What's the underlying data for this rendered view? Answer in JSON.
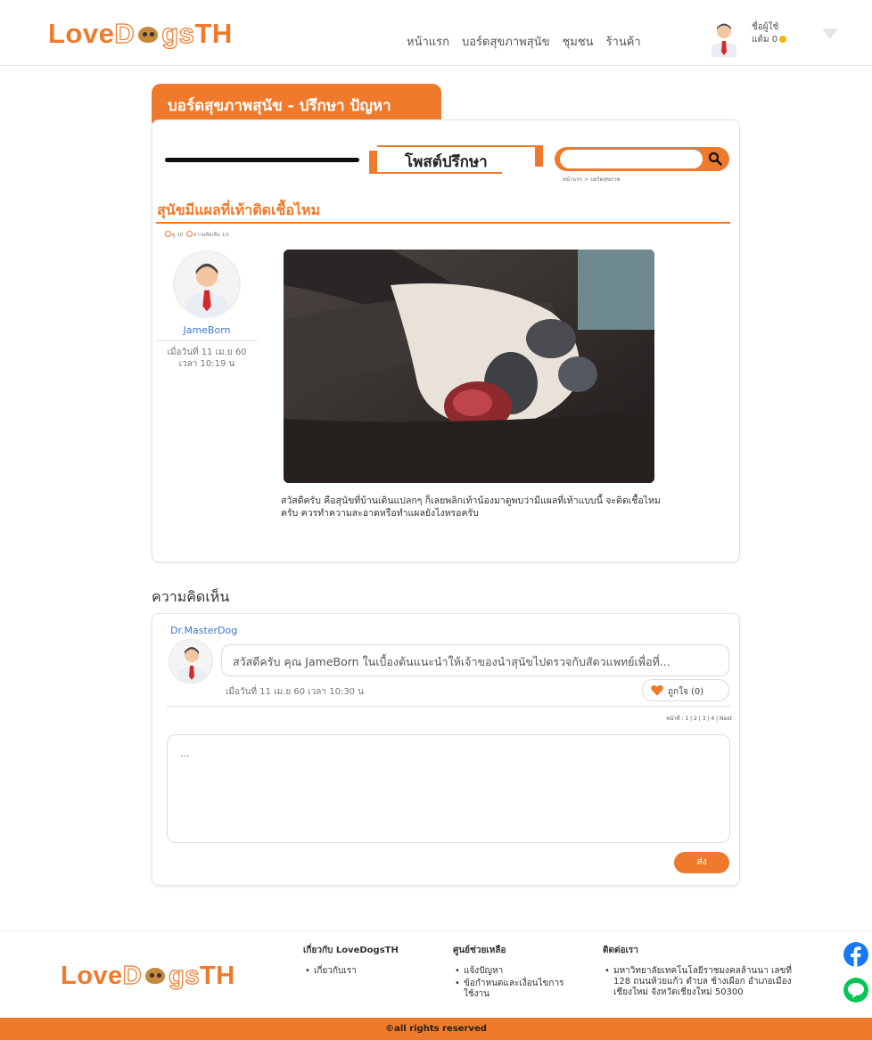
{
  "header": {
    "logo": {
      "part1": "Love",
      "part2": "D",
      "part3": "gs",
      "part4": "TH"
    },
    "nav": [
      "หน้าแรก",
      "บอร์ดสุขภาพสุนัข",
      "ชุมชน",
      "ร้านค้า"
    ],
    "user": {
      "line1": "ชื่อผู้ใช้",
      "line2": "แต้ม 0"
    }
  },
  "board": {
    "tab_title": "บอร์ดสุขภาพสุนัข - ปรึกษา ปัญหา",
    "post_heading": "โพสต์ปรึกษา",
    "search": {
      "placeholder": ""
    },
    "breadcrumb": "หน้าแรก > บอร์ดสุขภาพ"
  },
  "post": {
    "title": "สุนัขมีแผลที่เท้าติดเชื้อไหม",
    "views": "ดู 10",
    "replies": "ความคิดเห็น 1/1",
    "author": "JameBorn",
    "date_line1": "เมื่อวันที่ 11 เม.ย 60",
    "date_line2": "เวลา 10:19 น",
    "body": "สวัสดีครับ คือสุนัขที่บ้านเดินแปลกๆ ก็เลยพลิกเท้าน้องมาดูพบว่ามีแผลที่เท้าแบบนี้ จะติดเชื้อไหมครับ ควรทำความสะอาดหรือทำแผลยังไงหรอครับ"
  },
  "comments": {
    "heading": "ความคิดเห็น",
    "items": [
      {
        "author": "Dr.MasterDog",
        "text": "สวัสดีครับ คุณ JameBorn ในเบื้องต้นแนะนำให้เจ้าของนำสุนัขไปตรวจกับสัตวแพทย์เพื่อที่...",
        "date": "เมื่อวันที่ 11 เม.ย 60 เวลา 10:30 น",
        "like_label": "ถูกใจ (0)"
      }
    ],
    "pagination": "หน้าที่ : 1 | 2 | 3 | 4 | Next",
    "reply_placeholder": "...",
    "send_label": "ส่ง"
  },
  "footer": {
    "about": {
      "heading": "เกี่ยวกับ LoveDogsTH",
      "items": [
        "เกี่ยวกับเรา"
      ]
    },
    "help": {
      "heading": "ศูนย์ช่วยเหลือ",
      "items": [
        "แจ้งปัญหา",
        "ข้อกำหนดและเงื่อนไขการใช้งาน"
      ]
    },
    "contact": {
      "heading": "ติดต่อเรา",
      "items": [
        "มหาวิทยาลัยเทคโนโลยีราชมงคลล้านนา เลขที่ 128 ถนนห้วยแก้ว ตำบล ช้างเผือก อำเภอเมืองเชียงใหม่ จังหวัดเชียงใหม่ 50300"
      ]
    },
    "copyright": "©all rights reserved"
  },
  "colors": {
    "accent": "#f07a2b",
    "link": "#3a78c9"
  },
  "icons": [
    "search-icon",
    "heart-icon",
    "facebook-icon",
    "line-icon",
    "eye-icon",
    "comment-icon"
  ]
}
